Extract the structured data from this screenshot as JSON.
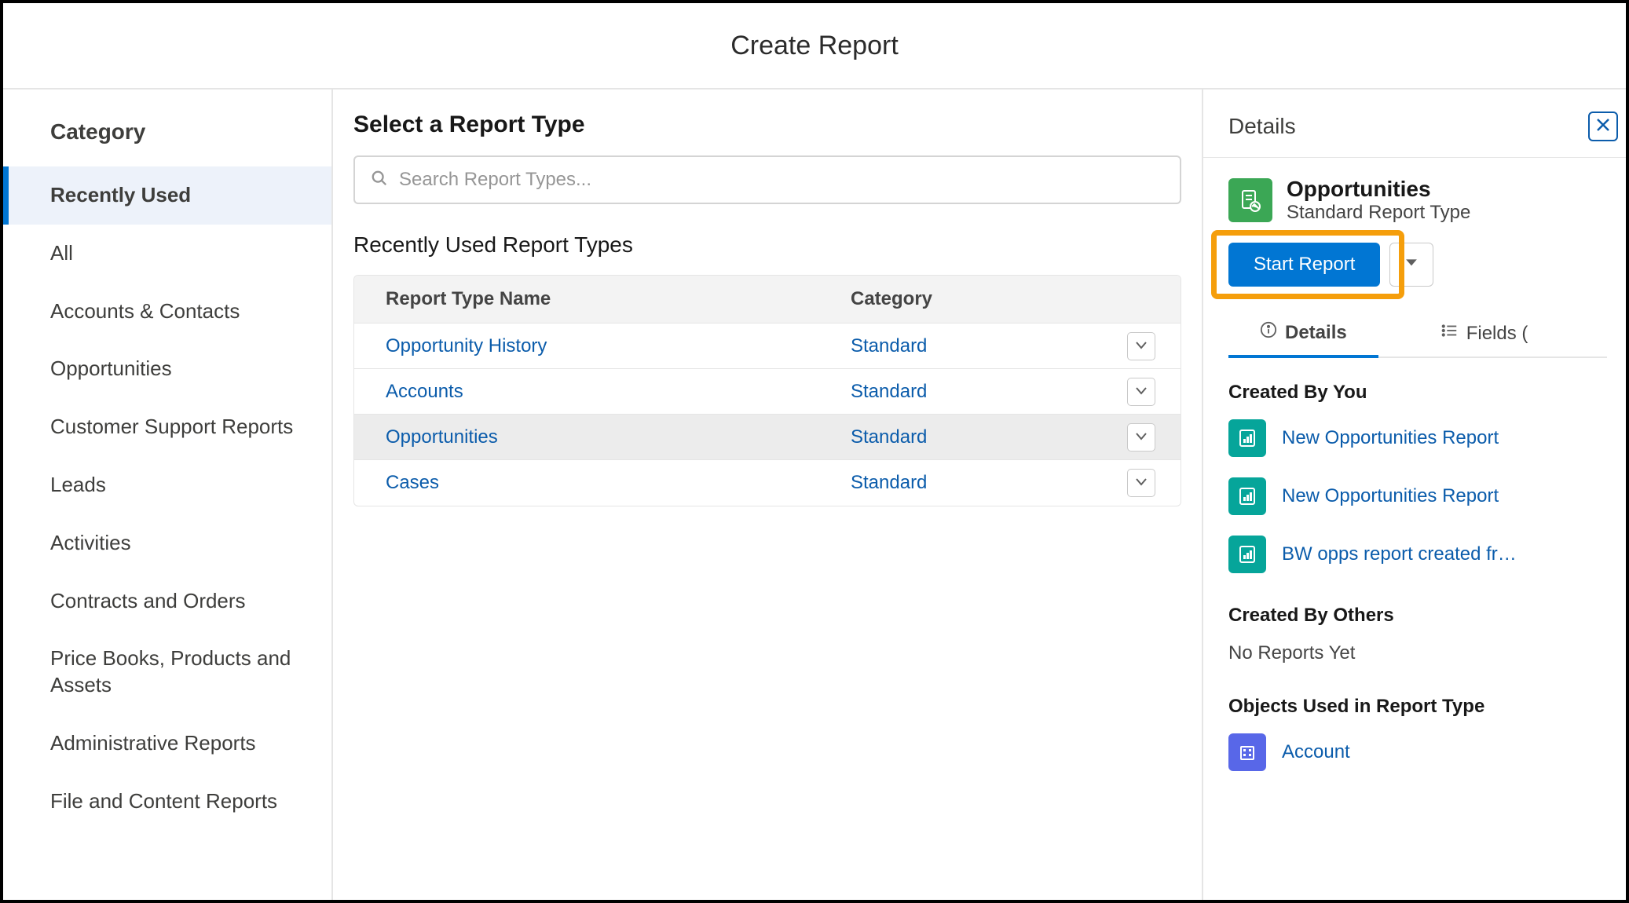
{
  "modal": {
    "title": "Create Report"
  },
  "sidebar": {
    "header": "Category",
    "items": [
      {
        "label": "Recently Used",
        "active": true
      },
      {
        "label": "All"
      },
      {
        "label": "Accounts & Contacts"
      },
      {
        "label": "Opportunities"
      },
      {
        "label": "Customer Support Reports"
      },
      {
        "label": "Leads"
      },
      {
        "label": "Activities"
      },
      {
        "label": "Contracts and Orders"
      },
      {
        "label": "Price Books, Products and Assets"
      },
      {
        "label": "Administrative Reports"
      },
      {
        "label": "File and Content Reports"
      }
    ]
  },
  "main": {
    "heading": "Select a Report Type",
    "search_placeholder": "Search Report Types...",
    "section_title": "Recently Used Report Types",
    "columns": {
      "name": "Report Type Name",
      "category": "Category"
    },
    "rows": [
      {
        "name": "Opportunity History",
        "category": "Standard"
      },
      {
        "name": "Accounts",
        "category": "Standard"
      },
      {
        "name": "Opportunities",
        "category": "Standard",
        "selected": true
      },
      {
        "name": "Cases",
        "category": "Standard"
      }
    ]
  },
  "details": {
    "header": "Details",
    "report_type": {
      "title": "Opportunities",
      "subtitle": "Standard Report Type"
    },
    "actions": {
      "start": "Start Report"
    },
    "tabs": {
      "details": "Details",
      "fields": "Fields ("
    },
    "created_by_you": {
      "title": "Created By You",
      "items": [
        "New Opportunities Report",
        "New Opportunities Report",
        "BW opps report created fr…"
      ]
    },
    "created_by_others": {
      "title": "Created By Others",
      "empty_text": "No Reports Yet"
    },
    "objects_used": {
      "title": "Objects Used in Report Type",
      "items": [
        "Account"
      ]
    }
  }
}
